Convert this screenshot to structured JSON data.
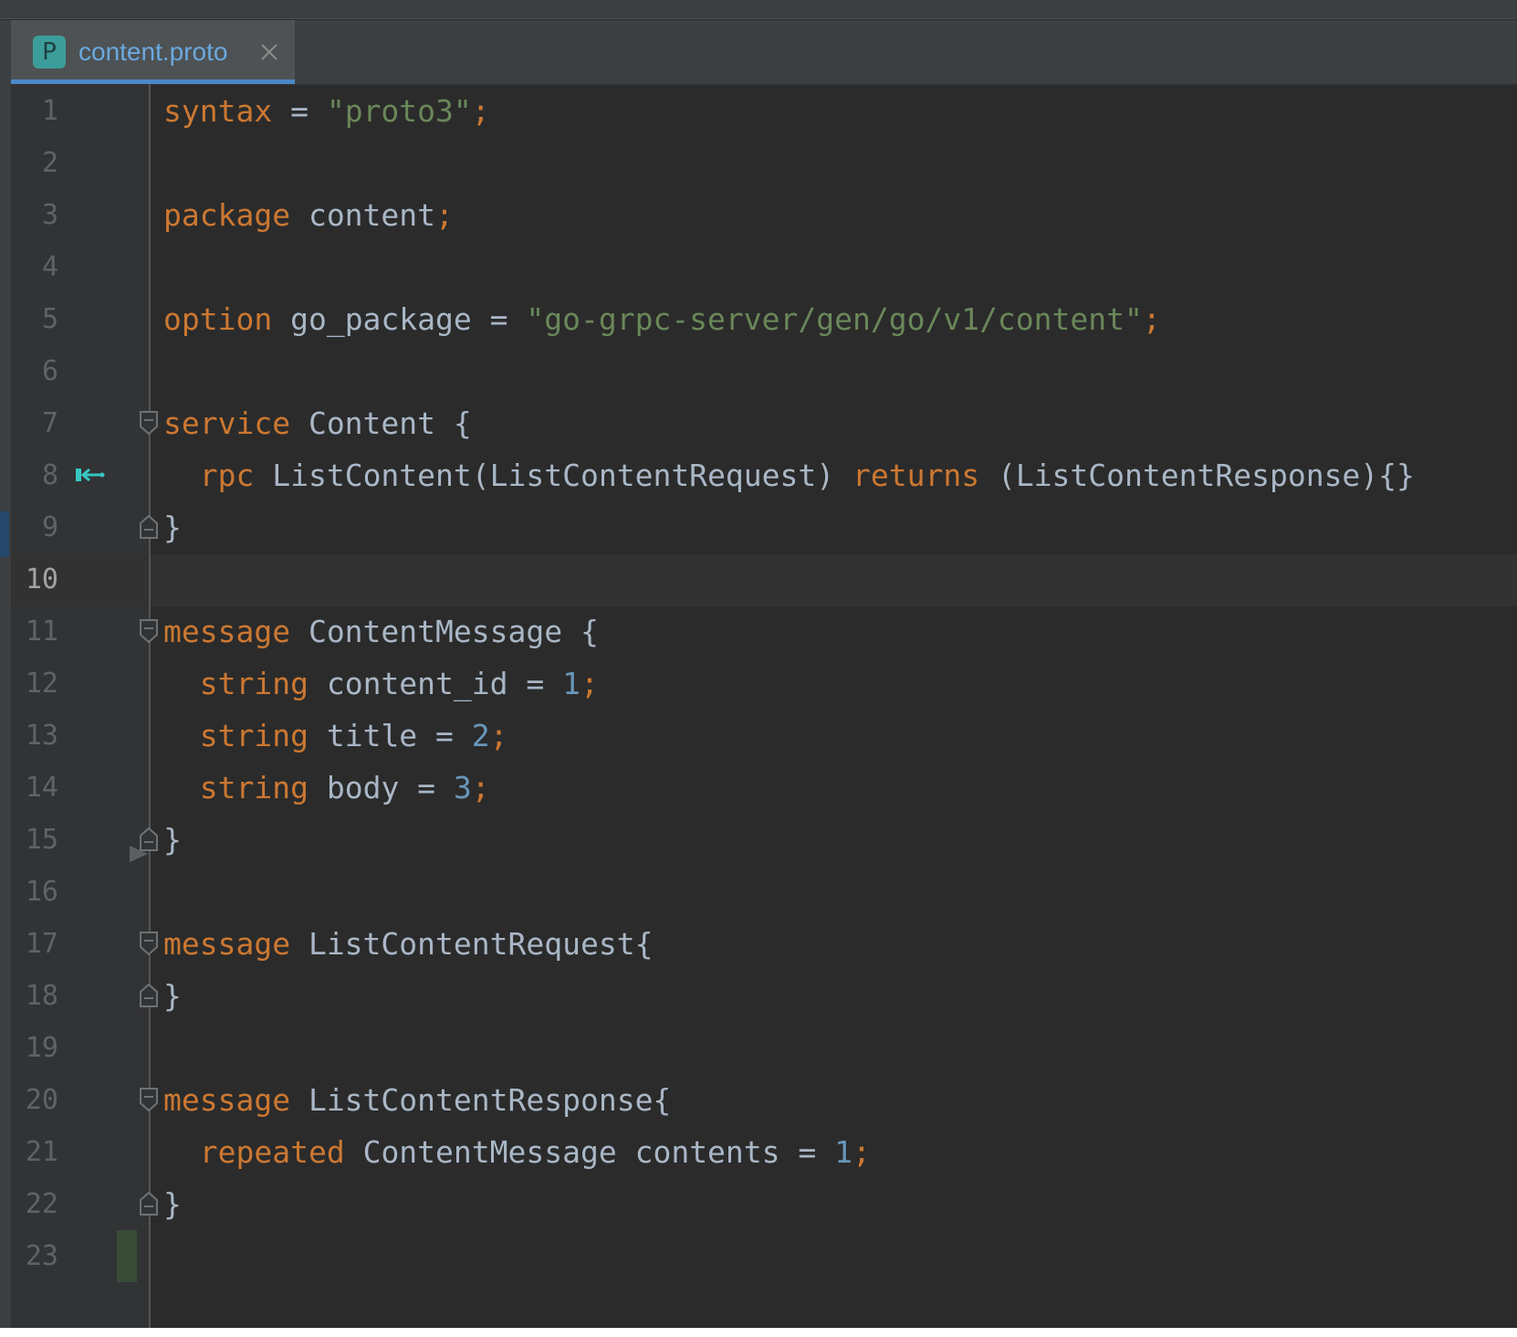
{
  "editor": {
    "tab": {
      "file_icon_letter": "P",
      "filename": "content.proto",
      "close_icon": "close-icon"
    },
    "current_line": 10,
    "lines": [
      {
        "n": "1",
        "tokens": [
          {
            "t": "syntax",
            "c": "kw"
          },
          {
            "t": " = ",
            "c": ""
          },
          {
            "t": "\"proto3\"",
            "c": "str"
          },
          {
            "t": ";",
            "c": "kw"
          }
        ]
      },
      {
        "n": "2",
        "tokens": []
      },
      {
        "n": "3",
        "tokens": [
          {
            "t": "package",
            "c": "kw"
          },
          {
            "t": " content",
            "c": ""
          },
          {
            "t": ";",
            "c": "kw"
          }
        ]
      },
      {
        "n": "4",
        "tokens": []
      },
      {
        "n": "5",
        "tokens": [
          {
            "t": "option",
            "c": "kw"
          },
          {
            "t": " go_package = ",
            "c": ""
          },
          {
            "t": "\"go-grpc-server/gen/go/v1/content\"",
            "c": "str"
          },
          {
            "t": ";",
            "c": "kw"
          }
        ]
      },
      {
        "n": "6",
        "tokens": []
      },
      {
        "n": "7",
        "fold": "open",
        "tokens": [
          {
            "t": "service",
            "c": "kw"
          },
          {
            "t": " Content {",
            "c": ""
          }
        ]
      },
      {
        "n": "8",
        "impl": true,
        "tokens": [
          {
            "t": "  ",
            "c": ""
          },
          {
            "t": "rpc",
            "c": "kw"
          },
          {
            "t": " ListContent(ListContentRequest) ",
            "c": ""
          },
          {
            "t": "returns",
            "c": "kw"
          },
          {
            "t": " (ListContentResponse){}",
            "c": ""
          }
        ]
      },
      {
        "n": "9",
        "fold": "close",
        "tokens": [
          {
            "t": "}",
            "c": ""
          }
        ]
      },
      {
        "n": "10",
        "tokens": []
      },
      {
        "n": "11",
        "fold": "open",
        "tokens": [
          {
            "t": "message",
            "c": "kw"
          },
          {
            "t": " ContentMessage {",
            "c": ""
          }
        ]
      },
      {
        "n": "12",
        "tokens": [
          {
            "t": "  ",
            "c": ""
          },
          {
            "t": "string",
            "c": "kw"
          },
          {
            "t": " content_id = ",
            "c": ""
          },
          {
            "t": "1",
            "c": "num"
          },
          {
            "t": ";",
            "c": "kw"
          }
        ]
      },
      {
        "n": "13",
        "tokens": [
          {
            "t": "  ",
            "c": ""
          },
          {
            "t": "string",
            "c": "kw"
          },
          {
            "t": " title = ",
            "c": ""
          },
          {
            "t": "2",
            "c": "num"
          },
          {
            "t": ";",
            "c": "kw"
          }
        ]
      },
      {
        "n": "14",
        "tokens": [
          {
            "t": "  ",
            "c": ""
          },
          {
            "t": "string",
            "c": "kw"
          },
          {
            "t": " body = ",
            "c": ""
          },
          {
            "t": "3",
            "c": "num"
          },
          {
            "t": ";",
            "c": "kw"
          }
        ]
      },
      {
        "n": "15",
        "fold": "close",
        "arrow": true,
        "tokens": [
          {
            "t": "}",
            "c": ""
          }
        ]
      },
      {
        "n": "16",
        "tokens": []
      },
      {
        "n": "17",
        "fold": "open",
        "tokens": [
          {
            "t": "message",
            "c": "kw"
          },
          {
            "t": " ListContentRequest{",
            "c": ""
          }
        ]
      },
      {
        "n": "18",
        "fold": "close",
        "tokens": [
          {
            "t": "}",
            "c": ""
          }
        ]
      },
      {
        "n": "19",
        "tokens": []
      },
      {
        "n": "20",
        "fold": "open",
        "tokens": [
          {
            "t": "message",
            "c": "kw"
          },
          {
            "t": " ListContentResponse{",
            "c": ""
          }
        ]
      },
      {
        "n": "21",
        "tokens": [
          {
            "t": "  ",
            "c": ""
          },
          {
            "t": "repeated",
            "c": "kw"
          },
          {
            "t": " ContentMessage contents = ",
            "c": ""
          },
          {
            "t": "1",
            "c": "num"
          },
          {
            "t": ";",
            "c": "kw"
          }
        ]
      },
      {
        "n": "22",
        "fold": "close",
        "tokens": [
          {
            "t": "}",
            "c": ""
          }
        ]
      },
      {
        "n": "23",
        "tokens": []
      }
    ]
  },
  "colors": {
    "background": "#2b2b2b",
    "keyword": "#cc7832",
    "string": "#6a8759",
    "number": "#6897bb",
    "text": "#a9b7c6",
    "tab_accent": "#4a88c7"
  }
}
